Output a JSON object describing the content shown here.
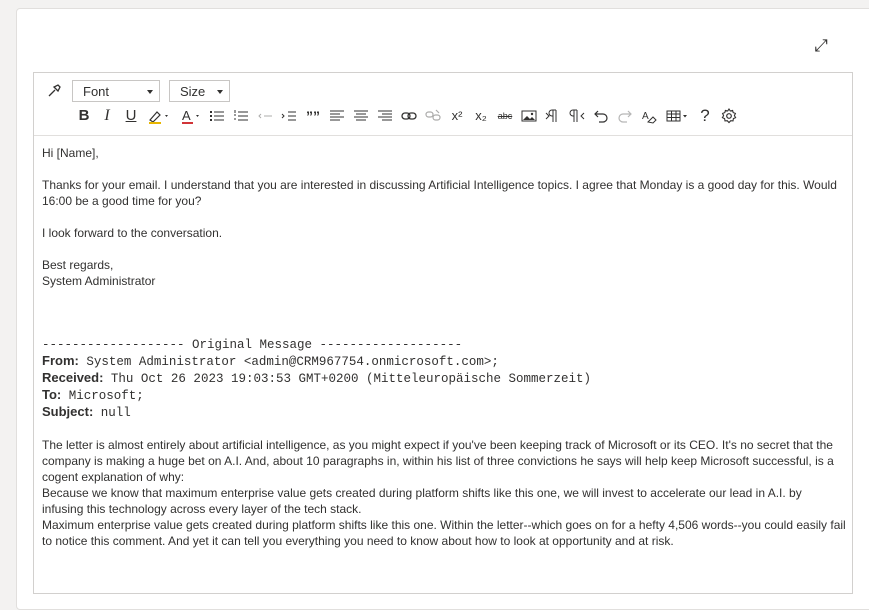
{
  "toolbar": {
    "font_label": "Font",
    "size_label": "Size",
    "bold": "B",
    "italic": "I",
    "underline": "U",
    "blockquote": "””",
    "superscript": "x²",
    "subscript": "x₂",
    "strikethrough": "abc",
    "help": "?"
  },
  "email": {
    "greeting": "Hi [Name],",
    "para1": "Thanks for your email. I understand that you are interested in discussing Artificial Intelligence topics. I agree that Monday is a good day for this. Would 16:00 be a good time for you?",
    "para2": "I look forward to the conversation.",
    "closing": "Best regards,",
    "signature": "System Administrator",
    "original_header": "------------------- Original Message -------------------",
    "from_label": "From:",
    "from_value": " System Administrator <admin@CRM967754.onmicrosoft.com>;",
    "received_label": "Received:",
    "received_value": " Thu Oct 26 2023 19:03:53 GMT+0200 (Mitteleuropäische Sommerzeit)",
    "to_label": "To:",
    "to_value": " Microsoft;",
    "subject_label": "Subject:",
    "subject_value": " null",
    "body1": "The letter is almost entirely about artificial intelligence, as you might expect if you've been keeping track of Microsoft or its CEO. It's no secret that the company is making a huge bet on A.I. And, about 10 paragraphs in, within his list of three convictions he says will help keep Microsoft successful, is a cogent explanation of why:",
    "body2": "Because we know that maximum enterprise value gets created during platform shifts like this one, we will invest to accelerate our lead in A.I. by infusing this technology across every layer of the tech stack.",
    "body3": "Maximum enterprise value gets created during platform shifts like this one. Within the letter--which goes on for a hefty 4,506 words--you could easily fail to notice this comment. And yet it can tell you everything you need to know about how to look at opportunity and at risk."
  }
}
